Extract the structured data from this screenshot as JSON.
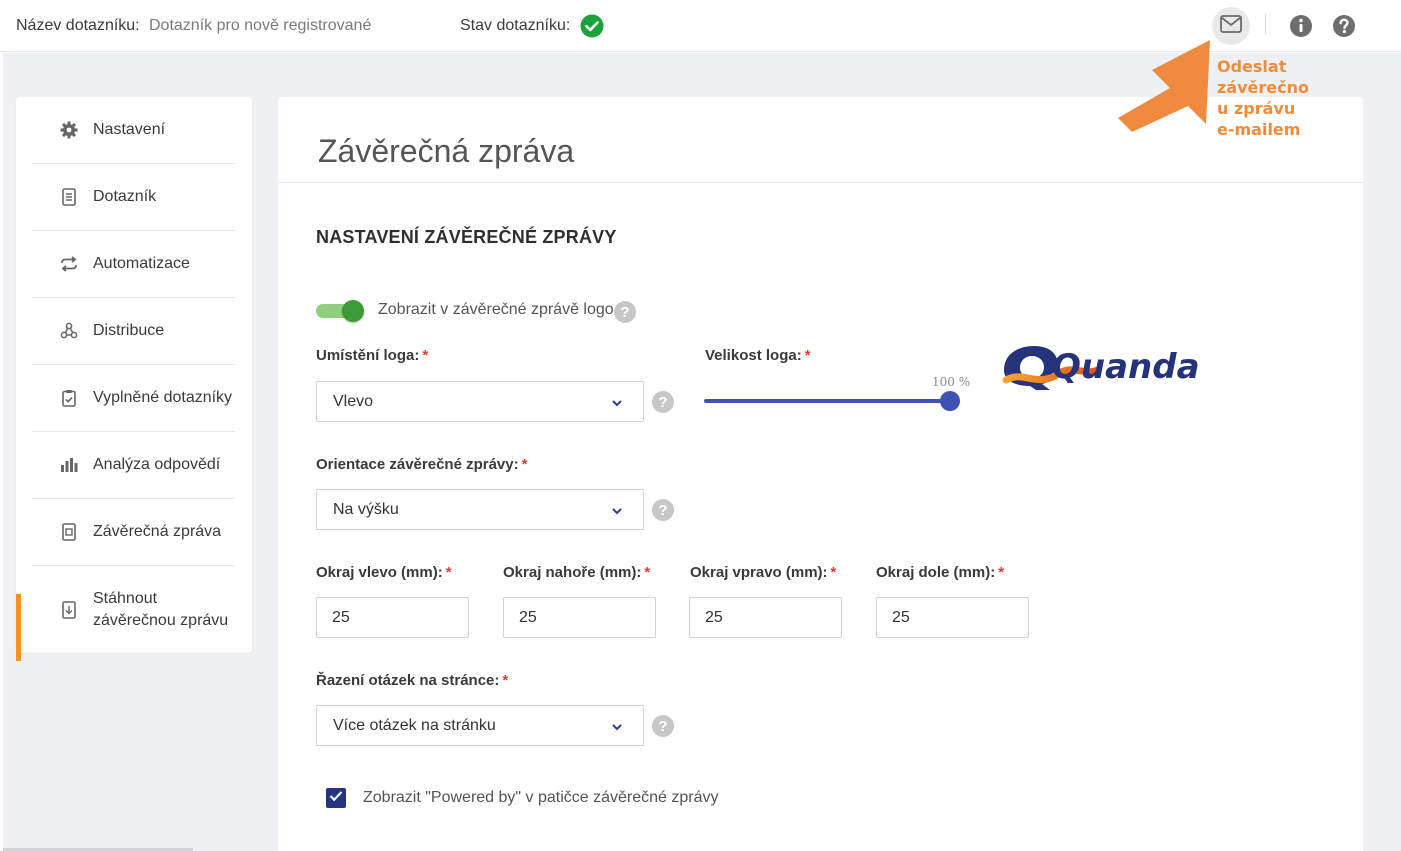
{
  "header": {
    "name_label": "Název dotazníku:",
    "name_value": "Dotazník pro nově registrované",
    "state_label": "Stav dotazníku:",
    "state_icon": "check-circle-icon",
    "state_color": "#1aa33b"
  },
  "sidebar": {
    "accent_color": "#f7931e",
    "items": [
      {
        "label": "Nastavení",
        "icon": "gear-icon"
      },
      {
        "label": "Dotazník",
        "icon": "document-icon"
      },
      {
        "label": "Automatizace",
        "icon": "repeat-icon"
      },
      {
        "label": "Distribuce",
        "icon": "share-icon"
      },
      {
        "label": "Vyplněné dotazníky",
        "icon": "clipboard-check-icon"
      },
      {
        "label": "Analýza odpovědí",
        "icon": "bar-chart-icon"
      },
      {
        "label": "Závěrečná zpráva",
        "icon": "report-icon",
        "active": true
      },
      {
        "label": "Stáhnout",
        "label2": "závěrečnou zprávu",
        "icon": "download-report-icon"
      }
    ]
  },
  "main": {
    "title": "Závěrečná zpráva",
    "section_title": "NASTAVENÍ ZÁVĚREČNÉ ZPRÁVY",
    "show_logo_toggle": {
      "label": "Zobrazit v závěrečné zprávě logo",
      "on": true
    },
    "logo_position": {
      "label": "Umístění loga:",
      "value": "Vlevo"
    },
    "logo_size": {
      "label": "Velikost loga:",
      "percent_label": "100 %",
      "value": 1.0
    },
    "logo_text": "Quanda",
    "orientation": {
      "label": "Orientace závěrečné zprávy:",
      "value": "Na výšku"
    },
    "margins": [
      {
        "label": "Okraj vlevo (mm):",
        "value": "25"
      },
      {
        "label": "Okraj nahoře (mm):",
        "value": "25"
      },
      {
        "label": "Okraj vpravo (mm):",
        "value": "25"
      },
      {
        "label": "Okraj dole (mm):",
        "value": "25"
      }
    ],
    "question_order": {
      "label": "Řazení otázek na stránce:",
      "value": "Více otázek na stránku"
    },
    "powered_by": {
      "label": "Zobrazit \"Powered by\" v patičce závěrečné zprávy",
      "checked": true
    },
    "required_mark": "*"
  },
  "annotation": {
    "lines": [
      "Odeslat",
      "závěrečno",
      "u zprávu",
      "e-mailem"
    ],
    "color": "#f08c3c"
  }
}
